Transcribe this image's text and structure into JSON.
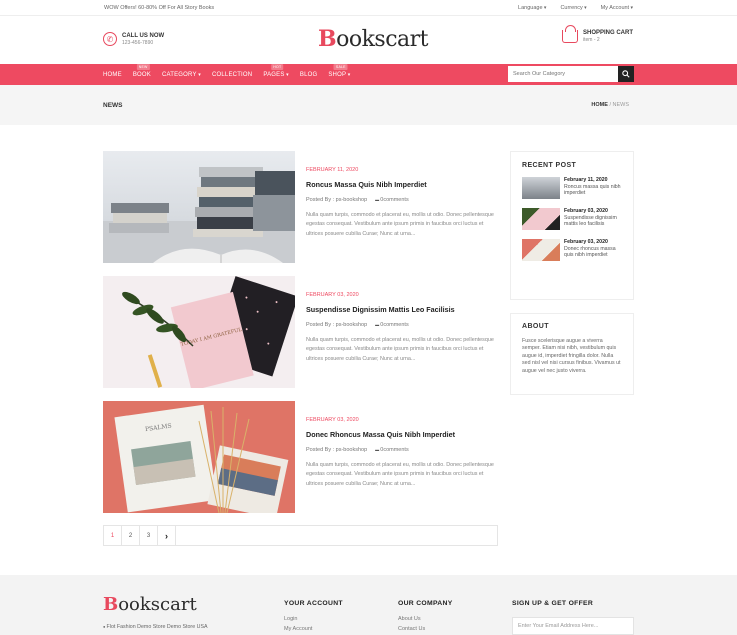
{
  "topbar": {
    "promo": "WOW Offers! 60-80% Off For All Story Books",
    "language": "Language",
    "currency": "Currency",
    "account": "My Account"
  },
  "header": {
    "call_title": "CALL US NOW",
    "call_number": "123-456-7890",
    "logo_b": "B",
    "logo_rest": "ookscart",
    "cart_title": "SHOPPING CART",
    "cart_items": "item - 2"
  },
  "nav": {
    "items": [
      {
        "label": "Home"
      },
      {
        "label": "Book",
        "badge": "New"
      },
      {
        "label": "Category"
      },
      {
        "label": "Collection"
      },
      {
        "label": "Pages",
        "badge": "Hot"
      },
      {
        "label": "Blog"
      },
      {
        "label": "Shop",
        "badge": "Sale"
      }
    ],
    "search_placeholder": "Search Our Category"
  },
  "breadcrumb": {
    "title": "News",
    "home": "Home",
    "sep": "/",
    "current": "News"
  },
  "posts": [
    {
      "date": "February 11, 2020",
      "title": "Roncus Massa Quis Nibh Imperdiet",
      "author": "Posted By : ps-bookshop",
      "comments": "0comments",
      "excerpt": "Nulla quam turpis, commodo et placerat eu, mollis ut odio. Donec pellentesque egestas consequat. Vestibulum ante ipsum primis in faucibus orci luctus et ultrices posuere cubilia Curae; Nunc at urna..."
    },
    {
      "date": "February 03, 2020",
      "title": "Suspendisse Dignissim Mattis Leo Facilisis",
      "author": "Posted By : ps-bookshop",
      "comments": "0comments",
      "excerpt": "Nulla quam turpis, commodo et placerat eu, mollis ut odio. Donec pellentesque egestas consequat. Vestibulum ante ipsum primis in faucibus orci luctus et ultrices posuere cubilia Curae; Nunc at urna..."
    },
    {
      "date": "February 03, 2020",
      "title": "Donec Rhoncus Massa Quis Nibh Imperdiet",
      "author": "Posted By : ps-bookshop",
      "comments": "0comments",
      "excerpt": "Nulla quam turpis, commodo et placerat eu, mollis ut odio. Donec pellentesque egestas consequat. Vestibulum ante ipsum primis in faucibus orci luctus et ultrices posuere cubilia Curae; Nunc at urna..."
    }
  ],
  "image_text": {
    "book_quote": "TODAY I AM GRATEFUL",
    "book_title": "PSALMS"
  },
  "pagination": {
    "pages": [
      "1",
      "2",
      "3"
    ],
    "next": "›"
  },
  "sidebar": {
    "recent_title": "Recent Post",
    "recent": [
      {
        "date": "February 11, 2020",
        "title": "Roncus massa quis nibh imperdiet"
      },
      {
        "date": "February 03, 2020",
        "title": "Suspendisse dignissim mattis leo facilisis"
      },
      {
        "date": "February 03, 2020",
        "title": "Donec rhoncus massa quis nibh imperdiet"
      }
    ],
    "about_title": "About",
    "about_text": "Fusce scelerisque augue a viverra semper. Etiam nisi nibh, vestibulum quis augue id, imperdiet fringilla dolor. Nulla sed nisl vel nisi cursus finibus. Vivamus ut augue vel nec justo viverra."
  },
  "footer": {
    "logo_b": "B",
    "logo_rest": "ookscart",
    "address": "Flot Fashion Demo Store Demo Store USA",
    "account_title": "Your Account",
    "account_links": [
      "Login",
      "My Account"
    ],
    "company_title": "Our Company",
    "company_links": [
      "About Us",
      "Contact Us"
    ],
    "signup_title": "Sign Up & Get Offer",
    "email_placeholder": "Enter Your Email Address Here..."
  },
  "colors": {
    "accent": "#ee4a61",
    "dark": "#222222"
  }
}
